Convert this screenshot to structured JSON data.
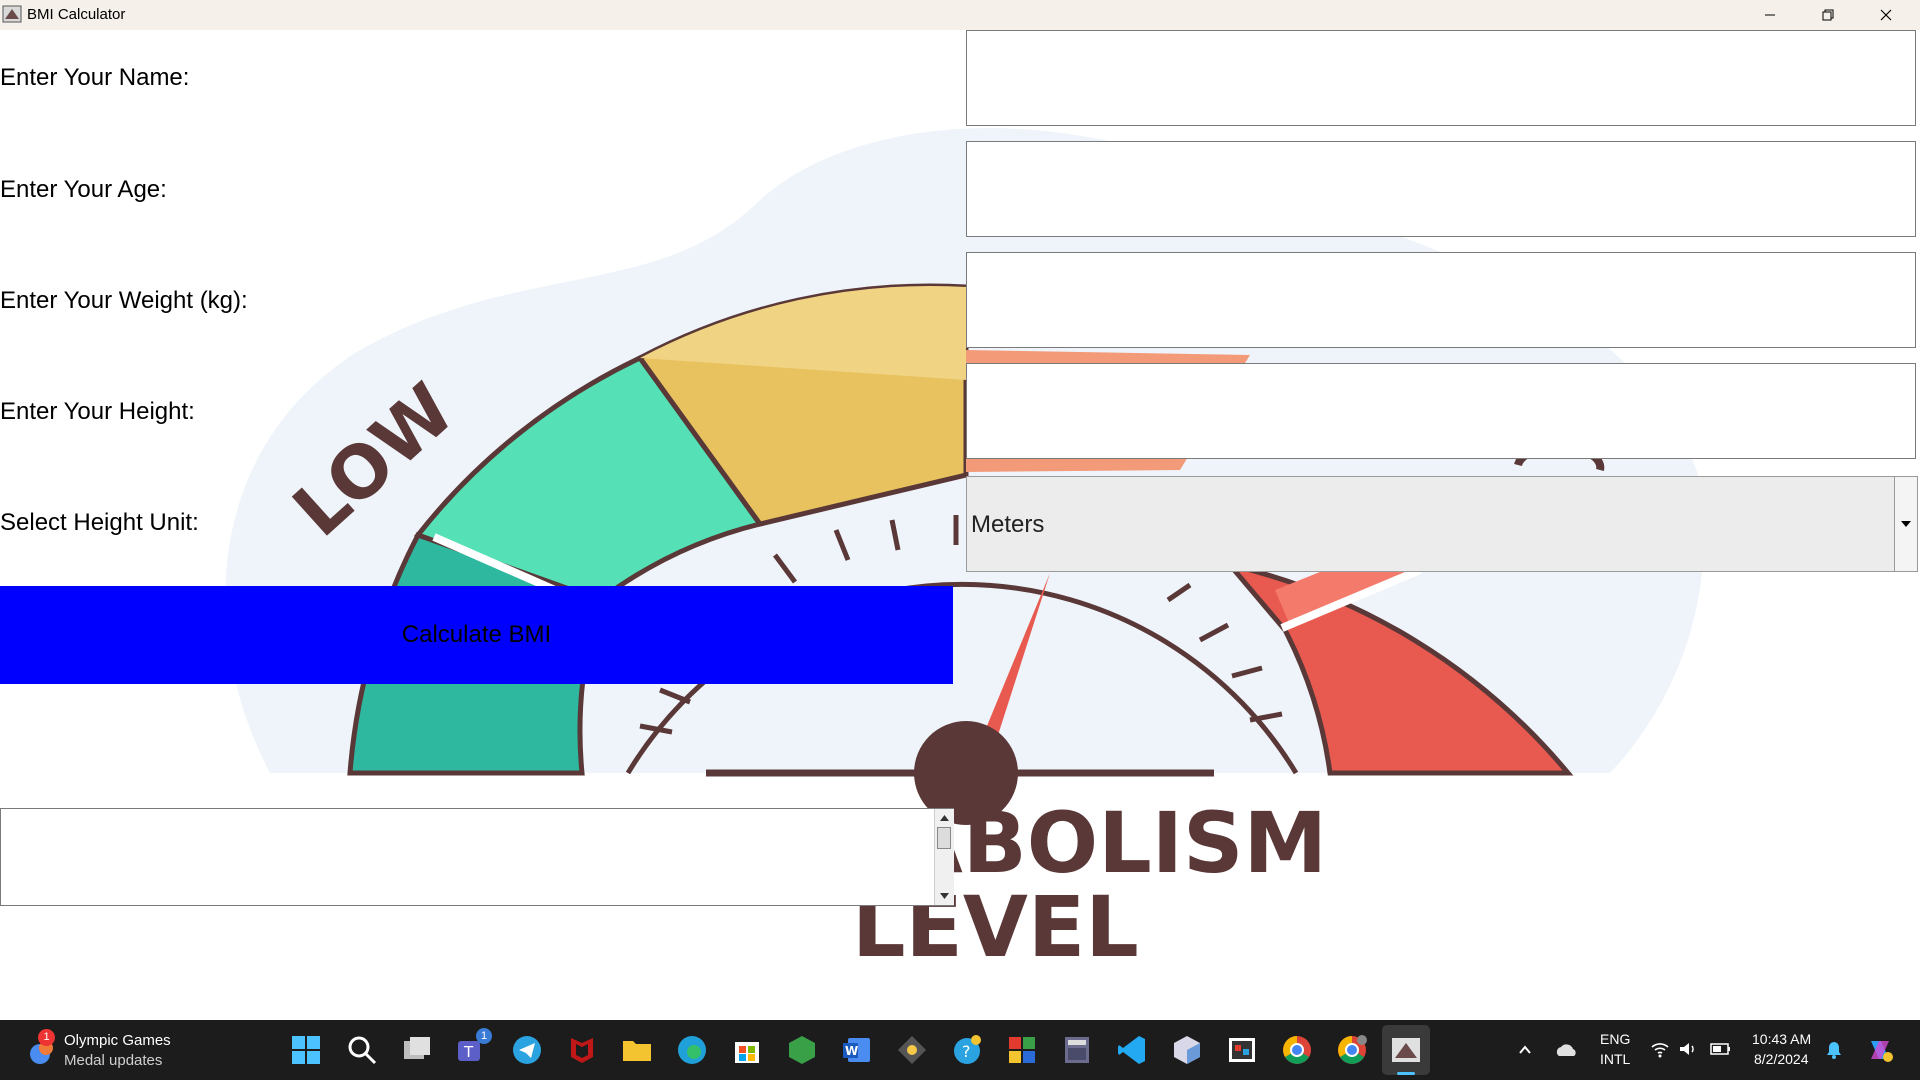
{
  "window": {
    "title": "BMI Calculator",
    "minimize_icon": "minimize-icon",
    "restore_icon": "restore-icon",
    "close_icon": "close-icon"
  },
  "form": {
    "name_label": "Enter Your Name:",
    "age_label": "Enter Your Age:",
    "weight_label": "Enter Your Weight (kg):",
    "height_label": "Enter Your Height:",
    "unit_label": "Select Height Unit:",
    "name_value": "",
    "age_value": "",
    "weight_value": "",
    "height_value": "",
    "unit_selected": "Meters",
    "calculate_label": "Calculate BMI",
    "result_value": ""
  },
  "background": {
    "gauge_word_low": "LOW",
    "caption_line1": "METABOLISM",
    "caption_line2": "LEVEL"
  },
  "taskbar": {
    "widget_title": "Olympic Games",
    "widget_subtitle": "Medal updates",
    "widget_badge": "1",
    "teams_badge": "1",
    "lang_line1": "ENG",
    "lang_line2": "INTL",
    "time": "10:43 AM",
    "date": "8/2/2024",
    "icons": [
      "start-icon",
      "search-icon",
      "task-view-icon",
      "teams-icon",
      "telegram-icon",
      "mcafee-icon",
      "file-explorer-icon",
      "edge-icon",
      "store-icon",
      "minecraft-icon",
      "word-icon",
      "git-icon",
      "help-icon",
      "app-tiles-icon",
      "calculator-icon",
      "vscode-icon",
      "box-app-icon",
      "screen-app-icon",
      "chrome-icon",
      "chrome-profile-icon",
      "bmi-app-icon"
    ]
  },
  "colors": {
    "button_bg": "#0000ff",
    "gauge_teal": "#2eb8a0",
    "gauge_green": "#55e0b5",
    "gauge_yellow": "#e8c25e",
    "gauge_orange": "#f39a78",
    "gauge_red": "#e85a4f",
    "gauge_outline": "#5a3838",
    "blob": "#eef4fa"
  }
}
